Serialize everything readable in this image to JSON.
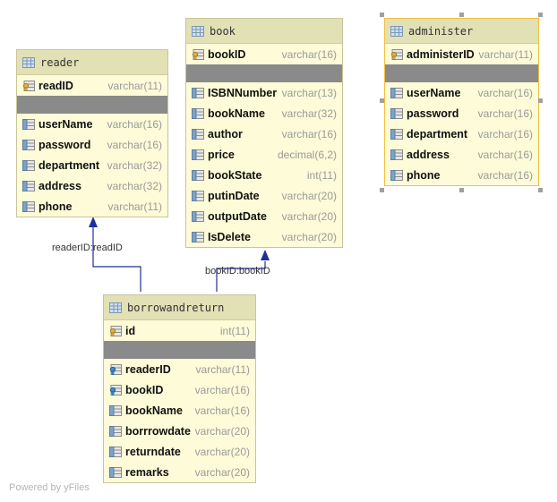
{
  "tables": {
    "reader": {
      "name": "reader",
      "pk": [
        {
          "name": "readID",
          "type": "varchar(11)",
          "icon": "primary-key-icon"
        }
      ],
      "fields": [
        {
          "name": "userName",
          "type": "varchar(16)",
          "icon": "column-icon"
        },
        {
          "name": "password",
          "type": "varchar(16)",
          "icon": "column-icon"
        },
        {
          "name": "department",
          "type": "varchar(32)",
          "icon": "column-icon"
        },
        {
          "name": "address",
          "type": "varchar(32)",
          "icon": "column-icon"
        },
        {
          "name": "phone",
          "type": "varchar(11)",
          "icon": "column-icon"
        }
      ]
    },
    "book": {
      "name": "book",
      "pk": [
        {
          "name": "bookID",
          "type": "varchar(16)",
          "icon": "primary-key-icon"
        }
      ],
      "fields": [
        {
          "name": "ISBNNumber",
          "type": "varchar(13)",
          "icon": "column-icon"
        },
        {
          "name": "bookName",
          "type": "varchar(32)",
          "icon": "column-icon"
        },
        {
          "name": "author",
          "type": "varchar(16)",
          "icon": "column-icon"
        },
        {
          "name": "price",
          "type": "decimal(6,2)",
          "icon": "column-icon"
        },
        {
          "name": "bookState",
          "type": "int(11)",
          "icon": "column-icon"
        },
        {
          "name": "putinDate",
          "type": "varchar(20)",
          "icon": "column-icon"
        },
        {
          "name": "outputDate",
          "type": "varchar(20)",
          "icon": "column-icon"
        },
        {
          "name": "IsDelete",
          "type": "varchar(20)",
          "icon": "column-icon"
        }
      ]
    },
    "administer": {
      "name": "administer",
      "pk": [
        {
          "name": "administerID",
          "type": "varchar(11)",
          "icon": "primary-key-icon"
        }
      ],
      "fields": [
        {
          "name": "userName",
          "type": "varchar(16)",
          "icon": "column-icon"
        },
        {
          "name": "password",
          "type": "varchar(16)",
          "icon": "column-icon"
        },
        {
          "name": "department",
          "type": "varchar(16)",
          "icon": "column-icon"
        },
        {
          "name": "address",
          "type": "varchar(16)",
          "icon": "column-icon"
        },
        {
          "name": "phone",
          "type": "varchar(16)",
          "icon": "column-icon"
        }
      ]
    },
    "borrowandreturn": {
      "name": "borrowandreturn",
      "pk": [
        {
          "name": "id",
          "type": "int(11)",
          "icon": "primary-key-icon"
        }
      ],
      "fields": [
        {
          "name": "readerID",
          "type": "varchar(11)",
          "icon": "foreign-key-icon"
        },
        {
          "name": "bookID",
          "type": "varchar(16)",
          "icon": "foreign-key-icon"
        },
        {
          "name": "bookName",
          "type": "varchar(16)",
          "icon": "column-icon"
        },
        {
          "name": "borrrowdate",
          "type": "varchar(20)",
          "icon": "column-icon"
        },
        {
          "name": "returndate",
          "type": "varchar(20)",
          "icon": "column-icon"
        },
        {
          "name": "remarks",
          "type": "varchar(20)",
          "icon": "column-icon"
        }
      ]
    }
  },
  "connections": [
    {
      "label": "readerID:readID",
      "from": "borrowandreturn",
      "to": "reader"
    },
    {
      "label": "bookID:bookID",
      "from": "borrowandreturn",
      "to": "book"
    }
  ],
  "colors": {
    "table_bg": "#fdfbd8",
    "header_bg": "#e2e0b5",
    "separator": "#8a8a8a",
    "connector": "#1f2f9a",
    "selection": "#f0c040"
  },
  "footer": "Powered by yFiles"
}
